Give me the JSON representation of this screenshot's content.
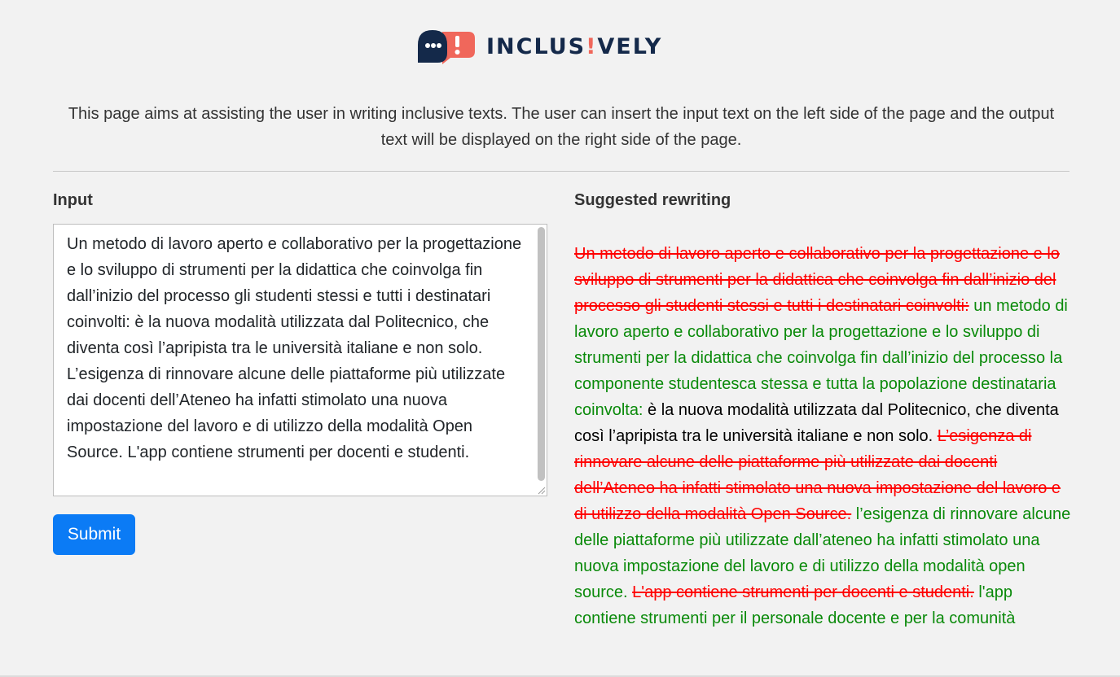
{
  "brand": {
    "name_part1": "INCLUS",
    "name_bang": "!",
    "name_part2": "VELY",
    "colors": {
      "navy": "#14294a",
      "coral": "#f0675b"
    }
  },
  "intro_text": "This page aims at assisting the user in writing inclusive texts. The user can insert the input text on the left side of the page and the output text will be displayed on the right side of the page.",
  "input": {
    "label": "Input",
    "value": "Un metodo di lavoro aperto e collaborativo per la progettazione e lo sviluppo di strumenti per la didattica che coinvolga fin dall’inizio del processo gli studenti stessi e tutti i destinatari coinvolti: è la nuova modalità utilizzata dal Politecnico, che diventa così l’apripista tra le università italiane e non solo. L’esigenza di rinnovare alcune delle piattaforme più utilizzate dai docenti dell’Ateneo ha infatti stimolato una nuova impostazione del lavoro e di utilizzo della modalità Open Source. L'app contiene strumenti per docenti e studenti."
  },
  "submit_label": "Submit",
  "output": {
    "label": "Suggested rewriting",
    "segments": [
      {
        "type": "del",
        "text": "Un metodo di lavoro aperto e collaborativo per la progettazione e lo sviluppo di strumenti per la didattica che coinvolga fin dall’inizio del processo gli studenti stessi e tutti i destinatari coinvolti:"
      },
      {
        "type": "ins",
        "text": " un metodo di lavoro aperto e collaborativo per la progettazione e lo sviluppo di strumenti per la didattica che coinvolga fin dall’inizio del processo la componente studentesca stessa e tutta la popolazione destinataria coinvolta:"
      },
      {
        "type": "same",
        "text": " è la nuova modalità utilizzata dal Politecnico, che diventa così l’apripista tra le università italiane e non solo. "
      },
      {
        "type": "del",
        "text": "L’esigenza di rinnovare alcune delle piattaforme più utilizzate dai docenti dell’Ateneo ha infatti stimolato una nuova impostazione del lavoro e di utilizzo della modalità Open Source."
      },
      {
        "type": "ins",
        "text": " l’esigenza di rinnovare alcune delle piattaforme più utilizzate dall’ateneo ha infatti stimolato una nuova impostazione del lavoro e di utilizzo della modalità open source. "
      },
      {
        "type": "del",
        "text": "L'app contiene strumenti per docenti e studenti."
      },
      {
        "type": "ins",
        "text": " l'app contiene strumenti per il personale docente e per la comunità"
      }
    ],
    "colors": {
      "deleted": "#ff0000",
      "inserted": "#0a8a0a",
      "unchanged": "#000000"
    }
  },
  "colors": {
    "accent": "#0b7bf5",
    "background": "#f2f2f2"
  }
}
